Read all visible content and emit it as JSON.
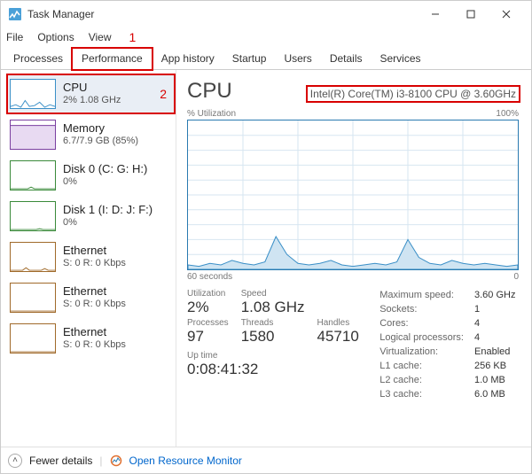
{
  "window": {
    "title": "Task Manager"
  },
  "menu": {
    "file": "File",
    "options": "Options",
    "view": "View"
  },
  "annotations": {
    "one": "1",
    "two": "2"
  },
  "tabs": {
    "processes": "Processes",
    "performance": "Performance",
    "app_history": "App history",
    "startup": "Startup",
    "users": "Users",
    "details": "Details",
    "services": "Services"
  },
  "sidebar": [
    {
      "name": "CPU",
      "sub": "2%  1.08 GHz",
      "color": "#3a8fc7",
      "selected": true
    },
    {
      "name": "Memory",
      "sub": "6.7/7.9 GB (85%)",
      "color": "#7a3fa0"
    },
    {
      "name": "Disk 0 (C: G: H:)",
      "sub": "0%",
      "color": "#3a8a3a"
    },
    {
      "name": "Disk 1 (I: D: J: F:)",
      "sub": "0%",
      "color": "#3a8a3a"
    },
    {
      "name": "Ethernet",
      "sub": "S: 0  R: 0 Kbps",
      "color": "#a06a2a"
    },
    {
      "name": "Ethernet",
      "sub": "S: 0  R: 0 Kbps",
      "color": "#a06a2a"
    },
    {
      "name": "Ethernet",
      "sub": "S: 0  R: 0 Kbps",
      "color": "#a06a2a"
    }
  ],
  "main": {
    "title": "CPU",
    "cpu_name": "Intel(R) Core(TM) i3-8100 CPU @ 3.60GHz",
    "util_label": "% Utilization",
    "util_max": "100%",
    "x_left": "60 seconds",
    "x_right": "0"
  },
  "stats": {
    "utilization": {
      "label": "Utilization",
      "value": "2%"
    },
    "speed": {
      "label": "Speed",
      "value": "1.08 GHz"
    },
    "processes": {
      "label": "Processes",
      "value": "97"
    },
    "threads": {
      "label": "Threads",
      "value": "1580"
    },
    "handles": {
      "label": "Handles",
      "value": "45710"
    },
    "uptime": {
      "label": "Up time",
      "value": "0:08:41:32"
    }
  },
  "facts": {
    "max_speed": {
      "k": "Maximum speed:",
      "v": "3.60 GHz"
    },
    "sockets": {
      "k": "Sockets:",
      "v": "1"
    },
    "cores": {
      "k": "Cores:",
      "v": "4"
    },
    "logical": {
      "k": "Logical processors:",
      "v": "4"
    },
    "virtualization": {
      "k": "Virtualization:",
      "v": "Enabled"
    },
    "l1": {
      "k": "L1 cache:",
      "v": "256 KB"
    },
    "l2": {
      "k": "L2 cache:",
      "v": "1.0 MB"
    },
    "l3": {
      "k": "L3 cache:",
      "v": "6.0 MB"
    }
  },
  "footer": {
    "fewer": "Fewer details",
    "resmon": "Open Resource Monitor"
  },
  "chart_data": {
    "type": "area",
    "title": "% Utilization",
    "xlabel": "seconds",
    "ylabel": "% Utilization",
    "xlim": [
      60,
      0
    ],
    "ylim": [
      0,
      100
    ],
    "x": [
      60,
      58,
      56,
      54,
      52,
      50,
      48,
      46,
      44,
      42,
      40,
      38,
      36,
      34,
      32,
      30,
      28,
      26,
      24,
      22,
      20,
      18,
      16,
      14,
      12,
      10,
      8,
      6,
      4,
      2,
      0
    ],
    "values": [
      3,
      2,
      4,
      3,
      6,
      4,
      3,
      5,
      22,
      10,
      4,
      3,
      4,
      6,
      3,
      2,
      3,
      4,
      3,
      5,
      20,
      8,
      4,
      3,
      6,
      4,
      3,
      4,
      3,
      2,
      3
    ]
  }
}
